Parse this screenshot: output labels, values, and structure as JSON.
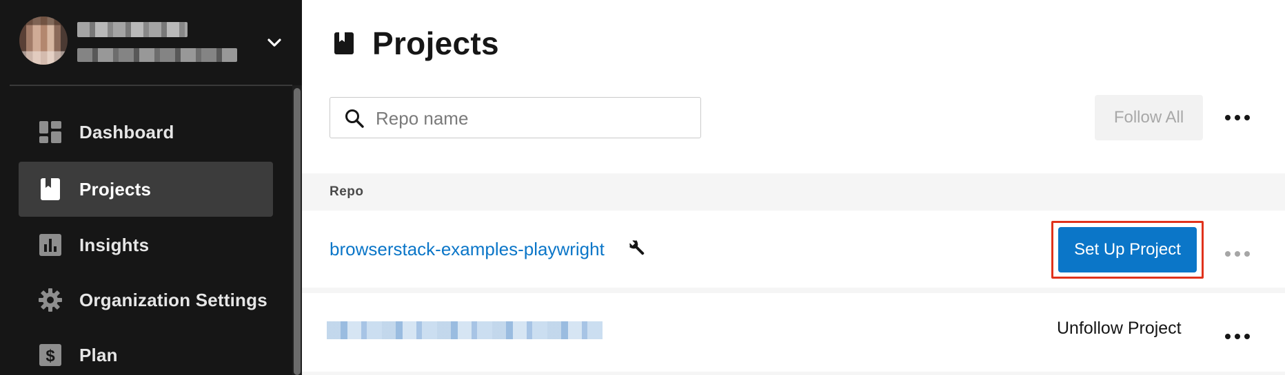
{
  "user": {
    "name_redacted": "",
    "org_redacted": ""
  },
  "sidebar": {
    "items": [
      {
        "label": "Dashboard",
        "icon": "dashboard-icon",
        "active": false
      },
      {
        "label": "Projects",
        "icon": "book-icon",
        "active": true
      },
      {
        "label": "Insights",
        "icon": "bar-chart-icon",
        "active": false
      },
      {
        "label": "Organization Settings",
        "icon": "gear-icon",
        "active": false
      },
      {
        "label": "Plan",
        "icon": "dollar-icon",
        "active": false
      }
    ]
  },
  "header": {
    "title": "Projects",
    "title_icon": "book-icon"
  },
  "search": {
    "placeholder": "Repo name",
    "value": ""
  },
  "toolbar": {
    "follow_all_label": "Follow All"
  },
  "table": {
    "columns": [
      "Repo"
    ],
    "rows": [
      {
        "repo": "browserstack-examples-playwright",
        "action": "Set Up Project",
        "has_wrench_icon": true
      },
      {
        "repo": "",
        "action": "Unfollow Project",
        "has_wrench_icon": false
      }
    ]
  },
  "colors": {
    "sidebar_bg": "#161616",
    "accent": "#0b76c8",
    "highlight_outline": "#e0321c"
  }
}
